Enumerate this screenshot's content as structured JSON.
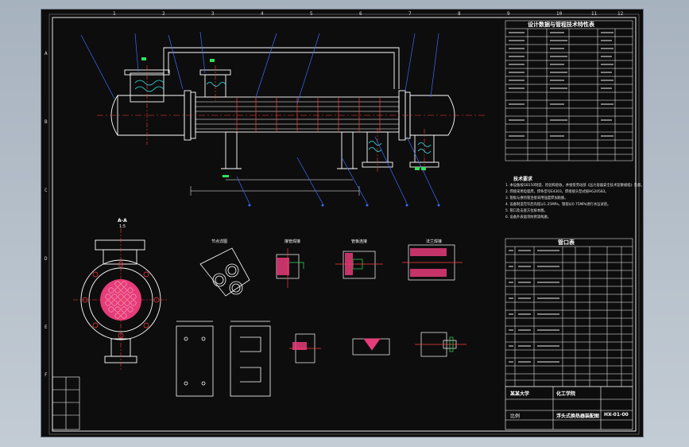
{
  "drawing": {
    "zone_letters": [
      "A",
      "B",
      "C",
      "D",
      "E",
      "F"
    ],
    "zone_numbers": [
      "1",
      "2",
      "3",
      "4",
      "5",
      "6",
      "7",
      "8",
      "9",
      "10",
      "11",
      "12"
    ],
    "view_label": "A-A",
    "view_scale": "1:5",
    "detail_label_1": "节点详图",
    "detail_label_2": "接管焊接",
    "detail_label_3": "管板连接",
    "detail_label_4": "法兰焊接"
  },
  "spec_table": {
    "title": "设计数据与管程技术特性表"
  },
  "notes": {
    "title": "技术要求",
    "lines": [
      "1. 本设备按GB150制造、检验和验收，并接受劳动部《压力容器安全技术监察规程》监督。",
      "2. 焊接采用电弧焊，焊条型号E4303，焊接接头型式按HG20583。",
      "3. 管板与换热管连接采用强度焊加贴胀。",
      "4. 设备制造完毕后壳程以1.25MPa，管程以0.75MPa进行水压试验。",
      "5. 管口及支座方位按本图。",
      "6. 设备外表面涂防锈漆两遍。"
    ]
  },
  "parts_table": {
    "title": "管口表"
  },
  "title_block": {
    "school": "某某大学",
    "dept": "化工学院",
    "drawing_name": "浮头式换热器装配图",
    "scale_label": "比例",
    "number": "HX-01-00"
  }
}
